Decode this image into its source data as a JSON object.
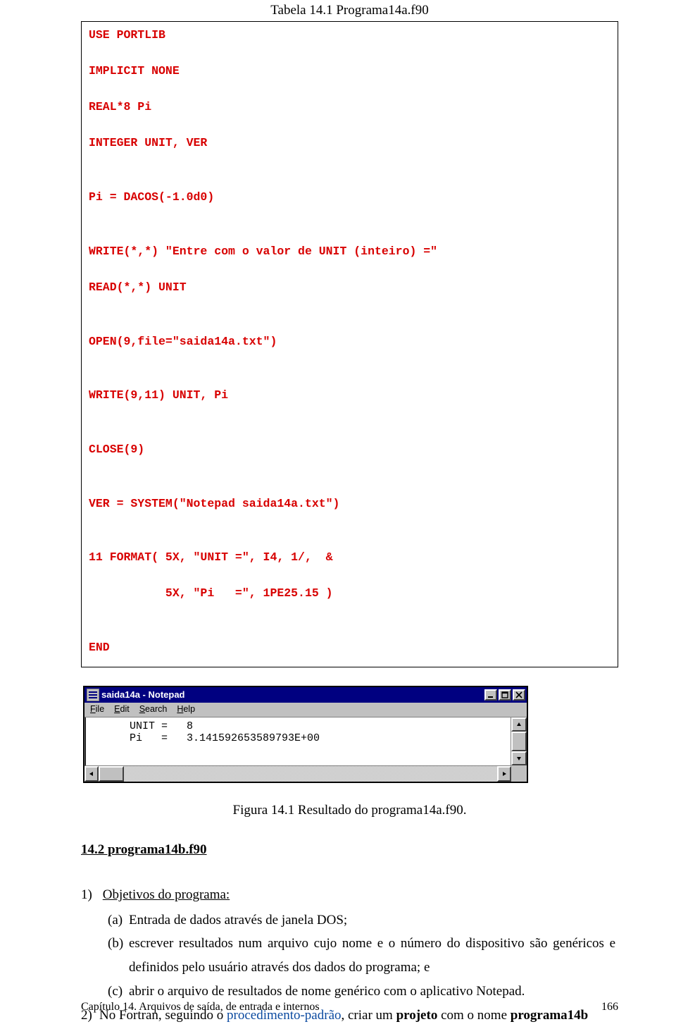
{
  "caption_top": "Tabela 14.1 Programa14a.f90",
  "code": "USE PORTLIB\n\nIMPLICIT NONE\n\nREAL*8 Pi\n\nINTEGER UNIT, VER\n\n\nPi = DACOS(-1.0d0)\n\n\nWRITE(*,*) \"Entre com o valor de UNIT (inteiro) =\"\n\nREAD(*,*) UNIT\n\n\nOPEN(9,file=\"saida14a.txt\")\n\n\nWRITE(9,11) UNIT, Pi\n\n\nCLOSE(9)\n\n\nVER = SYSTEM(\"Notepad saida14a.txt\")\n\n\n11 FORMAT( 5X, \"UNIT =\", I4, 1/,  &\n\n           5X, \"Pi   =\", 1PE25.15 )\n\n\nEND",
  "notepad": {
    "title": "saida14a - Notepad",
    "menus": {
      "file": "File",
      "edit": "Edit",
      "search": "Search",
      "help": "Help"
    },
    "text": "      UNIT =   8\n      Pi   =   3.141592653589793E+00"
  },
  "fig_caption": "Figura 14.1 Resultado do programa14a.f90.",
  "section_heading": "14.2 programa14b.f90",
  "list": {
    "n1": "1)",
    "obj_label": "Objetivos do programa:",
    "a_label": "(a)",
    "a_text": "Entrada de dados através de janela DOS;",
    "b_label": "(b)",
    "b_text": "escrever resultados num arquivo cujo nome e o número do dispositivo são genéricos e definidos pelo usuário através dos dados do programa; e",
    "c_label": "(c)",
    "c_text": "abrir o arquivo de resultados de nome genérico com o aplicativo Notepad.",
    "n2": "2)",
    "n2_pre": "No Fortran, seguindo o ",
    "n2_link": "procedimento-padrão",
    "n2_post": ", criar um ",
    "n2_bold": "projeto",
    "n2_tail": " com o nome ",
    "n2_name": "programa14b"
  },
  "footer": {
    "left": "Capítulo 14. Arquivos de saída, de entrada e internos",
    "right": "166"
  }
}
